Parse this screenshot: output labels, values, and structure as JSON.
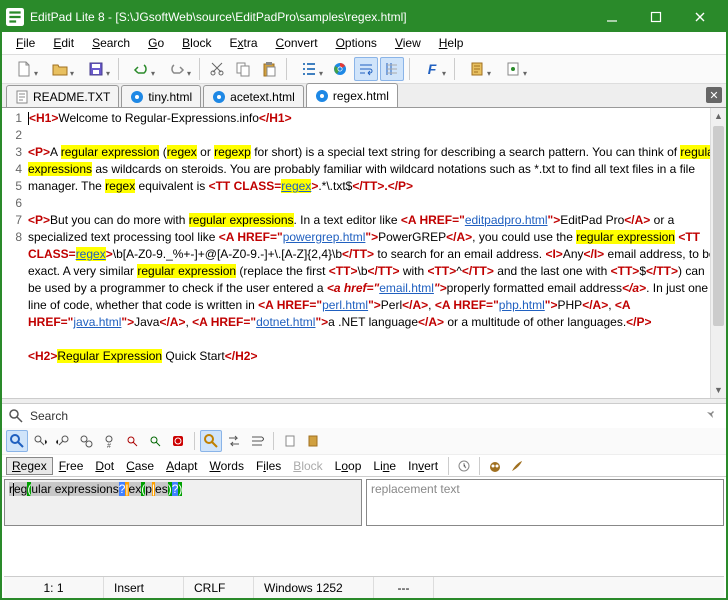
{
  "window": {
    "title": "EditPad Lite 8 - [S:\\JGsoftWeb\\source\\EditPadPro\\samples\\regex.html]"
  },
  "menu": {
    "file": "File",
    "edit": "Edit",
    "search": "Search",
    "go": "Go",
    "block": "Block",
    "extra": "Extra",
    "convert": "Convert",
    "options": "Options",
    "view": "View",
    "help": "Help"
  },
  "tabs": [
    {
      "label": "README.TXT",
      "icon": "txt"
    },
    {
      "label": "tiny.html",
      "icon": "html"
    },
    {
      "label": "acetext.html",
      "icon": "html"
    },
    {
      "label": "regex.html",
      "icon": "html",
      "active": true
    }
  ],
  "gutter": [
    "1",
    "2",
    "3",
    "",
    "",
    "4",
    "5",
    "",
    "",
    "",
    "",
    "",
    "",
    "6",
    "7",
    "8"
  ],
  "text": {
    "welcome": "Welcome to Regular-Expressions.info",
    "p1_a": "A ",
    "regex_expression": "regular expression",
    "p1_b": " (",
    "regex": "regex",
    "p1_c": " or ",
    "regexp": "regexp",
    "p1_d": " for short) is a special text string for describing a search pattern.  You can think of ",
    "regex_expressions": "regular expressions",
    "p1_e": " as wildcards on steroids.  You are probably familiar with wildcard notations such as *.txt to find all text files in a file manager.  The ",
    "p1_f": " equivalent is ",
    "tt_open": "<TT CLASS=",
    "tt_class": "regex",
    "tt_close": ">",
    "pat1": ".*\\.txt$",
    "tt_end": "</TT>",
    "p_end": ".</P>",
    "p2_a": "But you can do more with ",
    "p2_b": ".  In a text editor like ",
    "href_editpad": "editpadpro.html",
    "editpad": "EditPad Pro",
    "p2_c": " or a specialized text processing tool like ",
    "href_pg": "powergrep.html",
    "pg": "PowerGREP",
    "p2_d": ", you could use the ",
    "pat2": "\\b[A-Z0-9._%+-]+@[A-Z0-9.-]+\\.[A-Z]{2,4}\\b",
    "p2_e": " to search for an email address.  ",
    "any": "Any",
    "p2_f": " email address, to be exact.  A very similar ",
    "p2_g": " (replace the first ",
    "tt_b": "\\b",
    "p2_h": " with ",
    "tt_caret": "^",
    "p2_i": " and the last one with ",
    "tt_dollar": "$",
    "p2_j": ") can be used by a programmer to check if the user entered a ",
    "href_email": "email.html",
    "email_txt": "properly formatted email address",
    "p2_k": ".  In just one line of code, whether that code is written in ",
    "href_perl": "perl.html",
    "perl": "Perl",
    "href_php": "php.html",
    "php": "PHP",
    "href_java": "java.html",
    "java": "Java",
    "href_dotnet": "dotnet.html",
    "dotnet": "a .NET language",
    "p2_l": " or a multitude of other languages.",
    "re": "Regular Expression",
    "qs": " Quick Start"
  },
  "search": {
    "label": "Search",
    "regex_input": "reg(ular expressions?|ex(p|es)?)",
    "replace_placeholder": "replacement text",
    "opts": {
      "regex": "Regex",
      "free": "Free",
      "dot": "Dot",
      "case": "Case",
      "adapt": "Adapt",
      "words": "Words",
      "files": "Files",
      "block": "Block",
      "loop": "Loop",
      "line": "Line",
      "invert": "Invert"
    }
  },
  "status": {
    "pos": "1: 1",
    "insert": "Insert",
    "eol": "CRLF",
    "enc": "Windows 1252",
    "dash": "---"
  }
}
